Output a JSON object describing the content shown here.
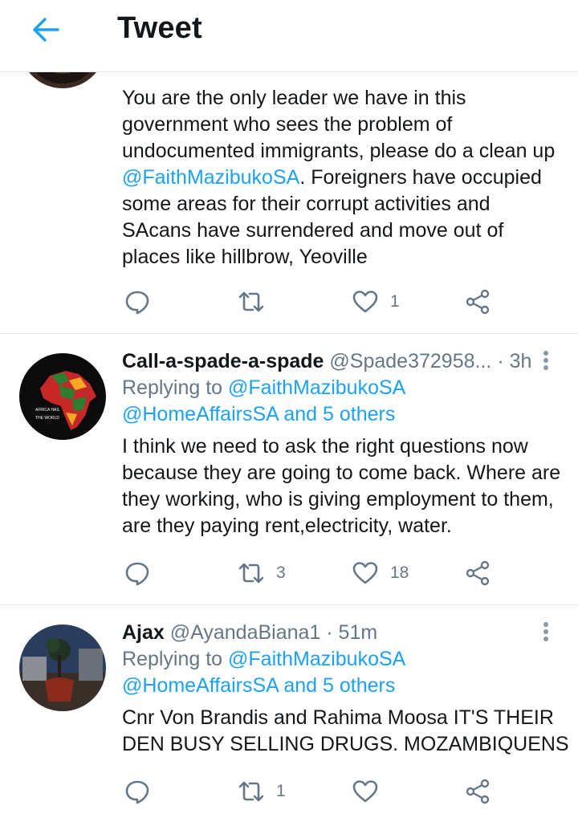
{
  "header": {
    "title": "Tweet",
    "back_icon": "arrow-left-icon",
    "accent": "#1da1f2"
  },
  "tweets": [
    {
      "lines": [
        "You are the only leader we have in this",
        "government who sees the problem of",
        "undocumented immigrants, please do a clean up"
      ],
      "mention": "@FaithMazibukoSA",
      "mention_rest": ". Foreigners have occupied",
      "lines2": [
        "some areas for their corrupt activities and",
        "SAcans have surrendered and move out of",
        "places like hillbrow, Yeoville"
      ],
      "retweets": "",
      "likes": "1"
    },
    {
      "name": "Call-a-spade-a-spade",
      "handle": "@Spade372958...",
      "time": "· 3h",
      "replying_prefix": "Replying to ",
      "replying_user": "@FaithMazibukoSA",
      "replying_line2": "@HomeAffairsSA and 5 others",
      "lines": [
        "I think we need to ask the right questions now",
        "because they are going to come back. Where are",
        "they working, who is giving employment to them,",
        "are they paying rent,electricity, water."
      ],
      "retweets": "3",
      "likes": "18"
    },
    {
      "name": "Ajax",
      "handle": "@AyandaBiana1",
      "time": "· 51m",
      "replying_prefix": "Replying to ",
      "replying_user": "@FaithMazibukoSA",
      "replying_line2": "@HomeAffairsSA and 5 others",
      "lines": [
        "Cnr Von Brandis and Rahima Moosa IT'S THEIR",
        "DEN BUSY SELLING DRUGS. MOZAMBIQUENS"
      ],
      "retweets": "1",
      "likes": ""
    }
  ],
  "colors": {
    "text": "#14171a",
    "secondary": "#657786",
    "link": "#1da1f2",
    "border": "#e1e8ed"
  }
}
